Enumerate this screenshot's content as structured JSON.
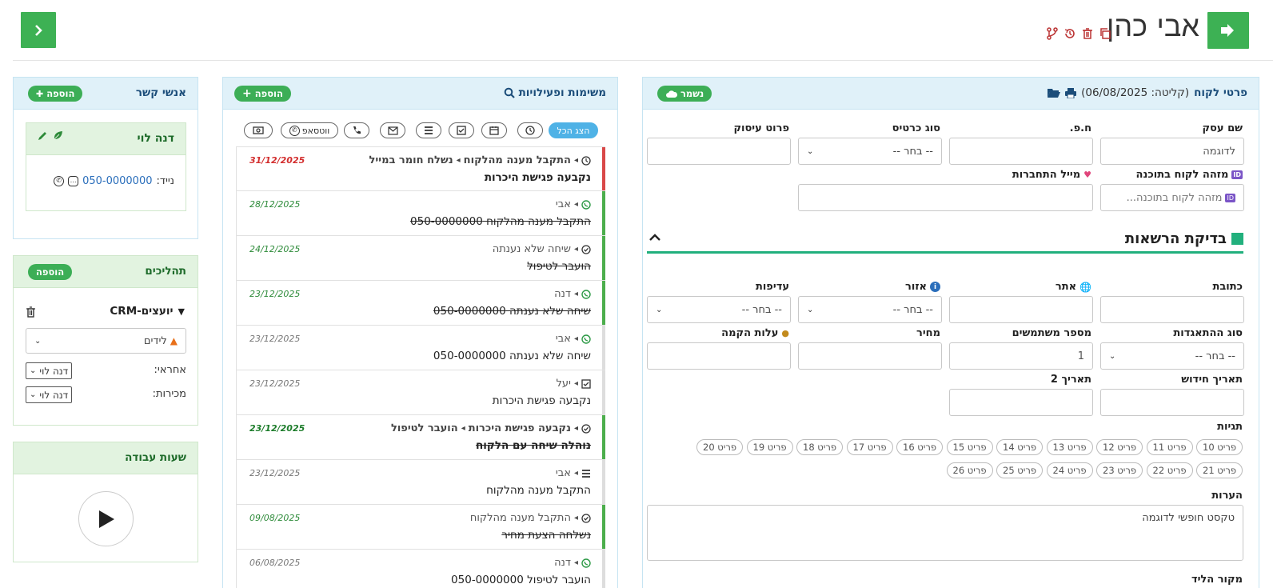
{
  "header": {
    "title": "אבי כהן",
    "accent": "#3db154"
  },
  "customer": {
    "panel_title": "פרטי לקוח",
    "received": "(קליטה: 06/08/2025)",
    "saved_label": "נשמר",
    "fields": {
      "business_name": {
        "label": "שם עסק",
        "value": "לדוגמה"
      },
      "company_id": {
        "label": "ח.פ.",
        "value": ""
      },
      "card_type": {
        "label": "סוג כרטיס",
        "value": "-- בחר --"
      },
      "occupation": {
        "label": "פרוט עיסוק",
        "value": ""
      },
      "software_id": {
        "label": "מזהה לקוח בתוכנה",
        "placeholder": "מזהה לקוח בתוכנה..."
      },
      "connect_mail": {
        "label": "מייל התחברות",
        "value": ""
      },
      "address": {
        "label": "כתובת",
        "value": ""
      },
      "website": {
        "label": "אתר",
        "value": ""
      },
      "region": {
        "label": "אזור",
        "value": "-- בחר --"
      },
      "priorities": {
        "label": "עדיפות",
        "value": "-- בחר --"
      },
      "corp_type": {
        "label": "סוג ההתאגדות",
        "value": "-- בחר --"
      },
      "users_count": {
        "label": "מספר משתמשים",
        "value": "1"
      },
      "price": {
        "label": "מחיר",
        "value": ""
      },
      "setup_cost": {
        "label": "עלות הקמה",
        "value": ""
      },
      "renew_date": {
        "label": "תאריך חידוש",
        "value": ""
      },
      "date2": {
        "label": "תאריך 2",
        "value": ""
      }
    },
    "section_title": "בדיקת הרשאות",
    "section_color": "#22b07d",
    "tags_label": "תגיות",
    "tags_row1": [
      "פריט 10",
      "פריט 11",
      "פריט 12",
      "פריט 13",
      "פריט 14",
      "פריט 15",
      "פריט 16",
      "פריט 17",
      "פריט 18",
      "פריט 19",
      "פריט 20"
    ],
    "tags_row2": [
      "פריט 21",
      "פריט 22",
      "פריט 23",
      "פריט 24",
      "פריט 25",
      "פריט 26"
    ],
    "notes_label": "הערות",
    "notes_value": "טקסט חופשי לדוגמה",
    "bottom_label": "מקור הליד"
  },
  "tasks": {
    "panel_title": "משימות ופעילויות",
    "add_label": "הוספה",
    "show_all": "הצג הכל",
    "whatsapp": "ווטסאפ",
    "items": [
      {
        "line1": "התקבל מענה מהלקוח",
        "line1b": "נשלח חומר במייל",
        "line2": "נקבעה פגישת היכרות",
        "date": "31/12/2025",
        "bar": "#d94848",
        "dcolor": "#d32f2f",
        "bold": true,
        "strike": false,
        "icon": "clock"
      },
      {
        "line1": "אבי",
        "line1b": "",
        "line2": "התקבל מענה מהלקוח 050-0000000",
        "date": "28/12/2025",
        "bar": "#4cae4c",
        "dcolor": "#2e8b3a",
        "bold": false,
        "strike": true,
        "icon": "whatsapp"
      },
      {
        "line1": "שיחה שלא נענתה",
        "line1b": "",
        "line2": "הועבר לטיפול",
        "date": "24/12/2025",
        "bar": "#4cae4c",
        "dcolor": "#2e8b3a",
        "bold": false,
        "strike": true,
        "icon": "check"
      },
      {
        "line1": "דנה",
        "line1b": "",
        "line2": "שיחה שלא נענתה 050-0000000",
        "date": "23/12/2025",
        "bar": "#4cae4c",
        "dcolor": "#2e8b3a",
        "bold": false,
        "strike": true,
        "icon": "whatsapp"
      },
      {
        "line1": "אבי",
        "line1b": "",
        "line2": "שיחה שלא נענתה 050-0000000",
        "date": "23/12/2025",
        "bar": "#dddddd",
        "dcolor": "#777777",
        "bold": false,
        "strike": false,
        "icon": "whatsapp"
      },
      {
        "line1": "יעל",
        "line1b": "",
        "line2": "נקבעה פגישת היכרות",
        "date": "23/12/2025",
        "bar": "#dddddd",
        "dcolor": "#777777",
        "bold": false,
        "strike": false,
        "icon": "checkbox"
      },
      {
        "line1": "נקבעה פגישת היכרות",
        "line1b": "הועבר לטיפול",
        "line2": "נוהלה שיחה עם הלקוח",
        "date": "23/12/2025",
        "bar": "#4cae4c",
        "dcolor": "#1e7d2c",
        "bold": true,
        "strike": true,
        "icon": "check"
      },
      {
        "line1": "אבי",
        "line1b": "",
        "line2": "התקבל מענה מהלקוח",
        "date": "23/12/2025",
        "bar": "#dddddd",
        "dcolor": "#777777",
        "bold": false,
        "strike": false,
        "icon": "list"
      },
      {
        "line1": "התקבל מענה מהלקוח",
        "line1b": "",
        "line2": "נשלחה הצעת מחיר",
        "date": "09/08/2025",
        "bar": "#4cae4c",
        "dcolor": "#2e8b3a",
        "bold": false,
        "strike": true,
        "icon": "check"
      },
      {
        "line1": "דנה",
        "line1b": "",
        "line2": "הועבר לטיפול 050-0000000",
        "date": "06/08/2025",
        "bar": "#dddddd",
        "dcolor": "#777777",
        "bold": false,
        "strike": false,
        "icon": "whatsapp"
      }
    ]
  },
  "contacts": {
    "panel_title": "אנשי קשר",
    "add_label": "הוספה",
    "card_name": "דנה לוי",
    "mobile_label": "נייד:",
    "mobile_value": "050-0000000"
  },
  "processes": {
    "panel_title": "תהליכים",
    "add_label": "הוספה",
    "pipeline_name": "CRM-יועצים",
    "stage": "לידים",
    "owner_label": "אחראי:",
    "owner_value": "דנה לוי",
    "sales_label": "מכירות:",
    "sales_value": "דנה לוי"
  },
  "hours": {
    "panel_title": "שעות עבודה"
  }
}
